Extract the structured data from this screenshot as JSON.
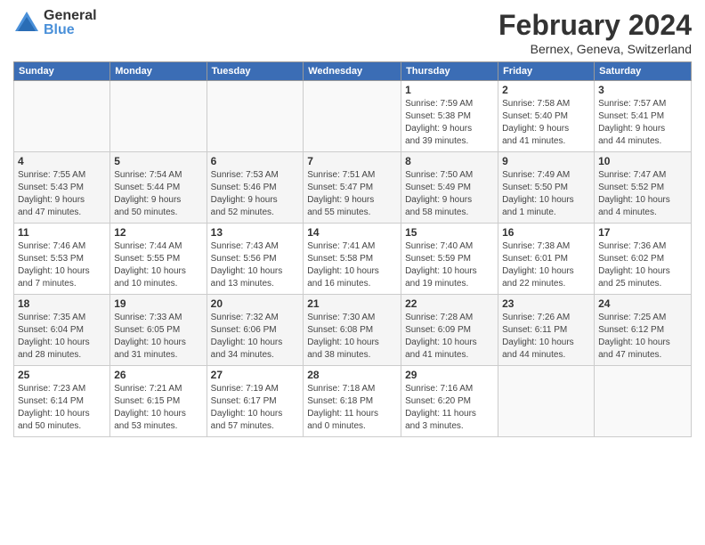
{
  "logo": {
    "general": "General",
    "blue": "Blue"
  },
  "header": {
    "title": "February 2024",
    "subtitle": "Bernex, Geneva, Switzerland"
  },
  "weekdays": [
    "Sunday",
    "Monday",
    "Tuesday",
    "Wednesday",
    "Thursday",
    "Friday",
    "Saturday"
  ],
  "weeks": [
    [
      {
        "day": "",
        "info": ""
      },
      {
        "day": "",
        "info": ""
      },
      {
        "day": "",
        "info": ""
      },
      {
        "day": "",
        "info": ""
      },
      {
        "day": "1",
        "info": "Sunrise: 7:59 AM\nSunset: 5:38 PM\nDaylight: 9 hours\nand 39 minutes."
      },
      {
        "day": "2",
        "info": "Sunrise: 7:58 AM\nSunset: 5:40 PM\nDaylight: 9 hours\nand 41 minutes."
      },
      {
        "day": "3",
        "info": "Sunrise: 7:57 AM\nSunset: 5:41 PM\nDaylight: 9 hours\nand 44 minutes."
      }
    ],
    [
      {
        "day": "4",
        "info": "Sunrise: 7:55 AM\nSunset: 5:43 PM\nDaylight: 9 hours\nand 47 minutes."
      },
      {
        "day": "5",
        "info": "Sunrise: 7:54 AM\nSunset: 5:44 PM\nDaylight: 9 hours\nand 50 minutes."
      },
      {
        "day": "6",
        "info": "Sunrise: 7:53 AM\nSunset: 5:46 PM\nDaylight: 9 hours\nand 52 minutes."
      },
      {
        "day": "7",
        "info": "Sunrise: 7:51 AM\nSunset: 5:47 PM\nDaylight: 9 hours\nand 55 minutes."
      },
      {
        "day": "8",
        "info": "Sunrise: 7:50 AM\nSunset: 5:49 PM\nDaylight: 9 hours\nand 58 minutes."
      },
      {
        "day": "9",
        "info": "Sunrise: 7:49 AM\nSunset: 5:50 PM\nDaylight: 10 hours\nand 1 minute."
      },
      {
        "day": "10",
        "info": "Sunrise: 7:47 AM\nSunset: 5:52 PM\nDaylight: 10 hours\nand 4 minutes."
      }
    ],
    [
      {
        "day": "11",
        "info": "Sunrise: 7:46 AM\nSunset: 5:53 PM\nDaylight: 10 hours\nand 7 minutes."
      },
      {
        "day": "12",
        "info": "Sunrise: 7:44 AM\nSunset: 5:55 PM\nDaylight: 10 hours\nand 10 minutes."
      },
      {
        "day": "13",
        "info": "Sunrise: 7:43 AM\nSunset: 5:56 PM\nDaylight: 10 hours\nand 13 minutes."
      },
      {
        "day": "14",
        "info": "Sunrise: 7:41 AM\nSunset: 5:58 PM\nDaylight: 10 hours\nand 16 minutes."
      },
      {
        "day": "15",
        "info": "Sunrise: 7:40 AM\nSunset: 5:59 PM\nDaylight: 10 hours\nand 19 minutes."
      },
      {
        "day": "16",
        "info": "Sunrise: 7:38 AM\nSunset: 6:01 PM\nDaylight: 10 hours\nand 22 minutes."
      },
      {
        "day": "17",
        "info": "Sunrise: 7:36 AM\nSunset: 6:02 PM\nDaylight: 10 hours\nand 25 minutes."
      }
    ],
    [
      {
        "day": "18",
        "info": "Sunrise: 7:35 AM\nSunset: 6:04 PM\nDaylight: 10 hours\nand 28 minutes."
      },
      {
        "day": "19",
        "info": "Sunrise: 7:33 AM\nSunset: 6:05 PM\nDaylight: 10 hours\nand 31 minutes."
      },
      {
        "day": "20",
        "info": "Sunrise: 7:32 AM\nSunset: 6:06 PM\nDaylight: 10 hours\nand 34 minutes."
      },
      {
        "day": "21",
        "info": "Sunrise: 7:30 AM\nSunset: 6:08 PM\nDaylight: 10 hours\nand 38 minutes."
      },
      {
        "day": "22",
        "info": "Sunrise: 7:28 AM\nSunset: 6:09 PM\nDaylight: 10 hours\nand 41 minutes."
      },
      {
        "day": "23",
        "info": "Sunrise: 7:26 AM\nSunset: 6:11 PM\nDaylight: 10 hours\nand 44 minutes."
      },
      {
        "day": "24",
        "info": "Sunrise: 7:25 AM\nSunset: 6:12 PM\nDaylight: 10 hours\nand 47 minutes."
      }
    ],
    [
      {
        "day": "25",
        "info": "Sunrise: 7:23 AM\nSunset: 6:14 PM\nDaylight: 10 hours\nand 50 minutes."
      },
      {
        "day": "26",
        "info": "Sunrise: 7:21 AM\nSunset: 6:15 PM\nDaylight: 10 hours\nand 53 minutes."
      },
      {
        "day": "27",
        "info": "Sunrise: 7:19 AM\nSunset: 6:17 PM\nDaylight: 10 hours\nand 57 minutes."
      },
      {
        "day": "28",
        "info": "Sunrise: 7:18 AM\nSunset: 6:18 PM\nDaylight: 11 hours\nand 0 minutes."
      },
      {
        "day": "29",
        "info": "Sunrise: 7:16 AM\nSunset: 6:20 PM\nDaylight: 11 hours\nand 3 minutes."
      },
      {
        "day": "",
        "info": ""
      },
      {
        "day": "",
        "info": ""
      }
    ]
  ]
}
